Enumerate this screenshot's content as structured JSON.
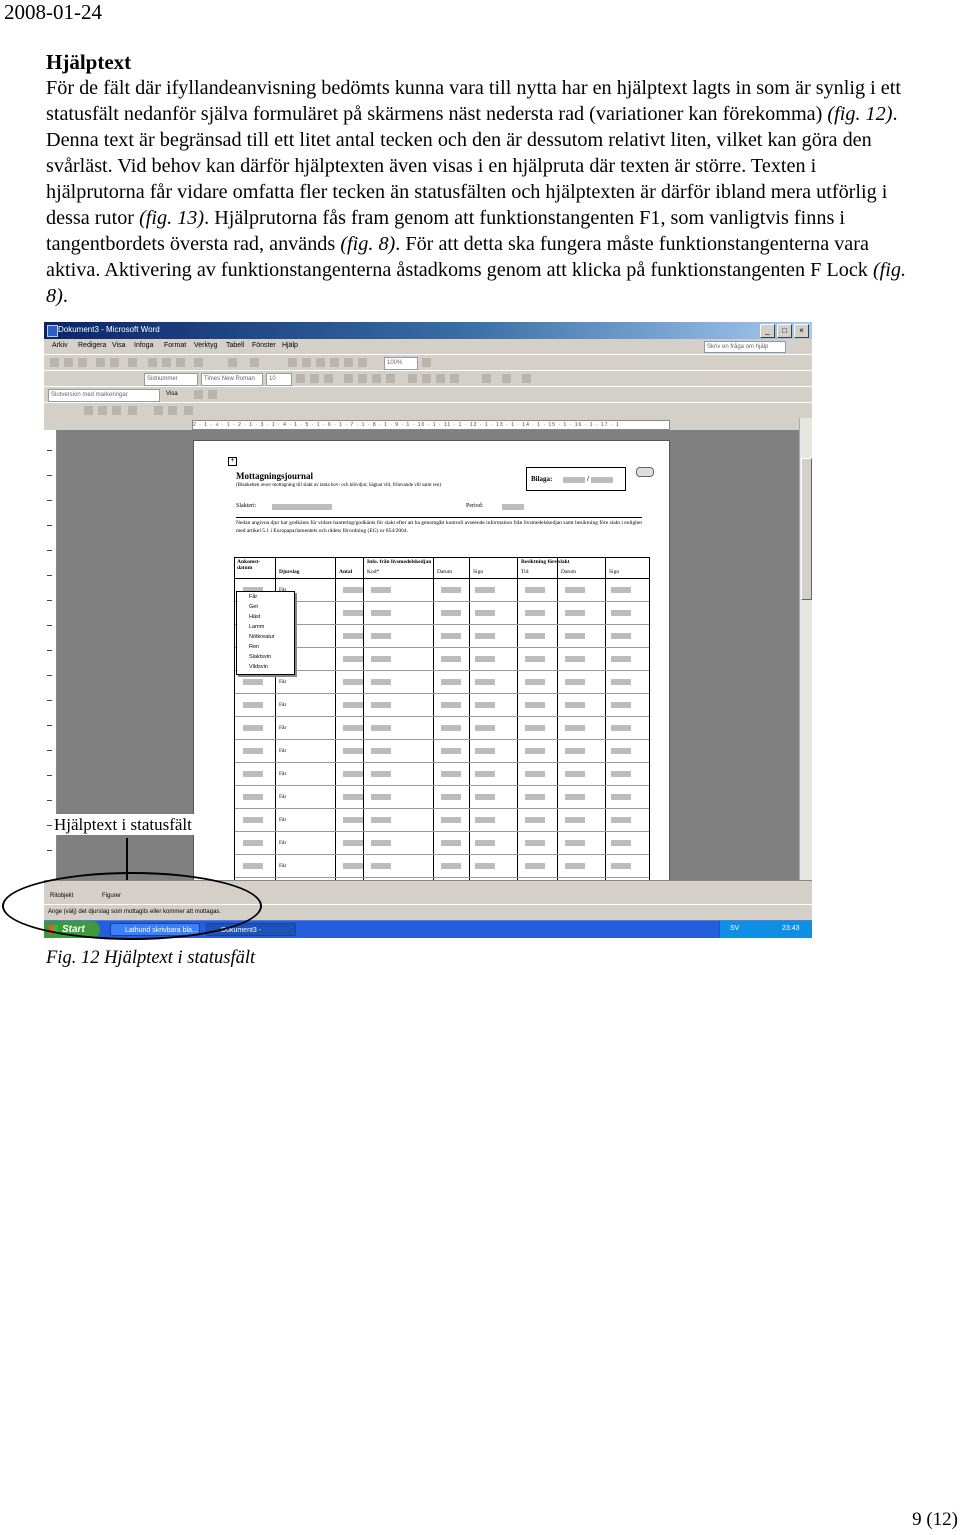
{
  "header": {
    "date": "2008-01-24"
  },
  "section": {
    "title": "Hjälptext"
  },
  "body": {
    "p1": "För de fält där ifyllandeanvisning bedömts kunna vara till nytta har en hjälptext lagts in som är synlig i ett statusfält nedanför själva formuläret på skärmens näst nedersta rad (variationer kan förekomma) ",
    "ref_fig12": "(fig. 12)",
    "p2": ". Denna text är begränsad till ett litet antal tecken och den är dessutom relativt liten, vilket kan göra den svårläst. Vid behov kan därför hjälptexten även visas i en hjälpruta där texten är större. Texten i hjälprutorna får vidare omfatta fler tecken än statusfälten och hjälptexten är därför ibland mera utförlig i dessa rutor ",
    "ref_fig13": "(fig. 13)",
    "p3": ". Hjälprutorna fås fram genom att funktionstangenten F1, som vanligtvis finns i tangentbordets översta rad, används ",
    "ref_fig8a": "(fig. 8)",
    "p4": ". För att detta ska fungera måste funktionstangenterna vara aktiva. Aktivering av funktionstangenterna åstadkoms genom att klicka på funktionstangenten F Lock ",
    "ref_fig8b": "(fig. 8)",
    "p5": "."
  },
  "screenshot": {
    "window_title": "Dokument3 - Microsoft Word",
    "menu": [
      "Arkiv",
      "Redigera",
      "Visa",
      "Infoga",
      "Format",
      "Verktyg",
      "Tabell",
      "Fönster",
      "Hjälp"
    ],
    "help_placeholder": "Skriv en fråga om hjälp",
    "zoom": "100%",
    "style_combo": "Sidnummer",
    "font_combo": "Times New Roman",
    "size_combo": "10",
    "track_combo": "Slutversion med markeringar",
    "show_label": "Visa",
    "ruler_text": "2 · 1 · ⅄ · 1 · 2 · 1 · 3 · 1 · 4 · 1 · 5 · 1 · 6 · 1 · 7 · 1 · 8 · 1 · 9 · 1 · 10 · 1 · 11 · 1 · 12 · 1 · 13 · 1 · 14 · 1 · 15 · 1 · 16 · 1 · 17 · 1",
    "form": {
      "title": "Mottagningsjournal",
      "subtitle": "(Blanketten avser mottagning till slakt av tama hov- och klövdjur, hägnat vilt, frilevande vilt samt ren)",
      "bilaga_label": "Bilaga:",
      "bilaga_sep": "/",
      "slakteri_label": "Slakteri:",
      "period_label": "Period:",
      "intro": "Nedan angivna djur har godkänts för vidare hantering/godkänts för slakt efter att ha genomgått kontroll avseende information från livsmedelskedjan samt besiktning före slakt i enlighet med artikel 5.1 i Europaparlamentets och rådets förordning (EG) nr 854/2004.",
      "columns": {
        "c1": "Ankomst-datum",
        "c2": "Djurslag",
        "c3": "Antal",
        "group1": "Info. från livsmedelskedjan",
        "c4": "Kod*",
        "c5": "Datum",
        "c6": "Sign",
        "group2": "Besiktning före slakt",
        "c7": "Tid",
        "c8": "Datum",
        "c9": "Sign"
      },
      "row_value": "Får",
      "dropdown_options": [
        "Får",
        "Get",
        "Häst",
        "Lamm",
        "Nötkreatur",
        "Ren",
        "Slaktsvin",
        "Vildsvin"
      ]
    },
    "draw_toolbar": {
      "ritobjekt": "Ritobjekt",
      "figurer": "Figurer"
    },
    "status_text": "Ange (välj) det djurslag som mottagits eller kommer att mottagas.",
    "taskbar": {
      "start": "Start",
      "task1": "Lathund skrivbara bla...",
      "task2": "Dokument3 - Microsof...",
      "lang": "SV",
      "clock": "23:43"
    },
    "annotation": "Hjälptext i statusfält"
  },
  "figure": {
    "caption": "Fig. 12 Hjälptext i statusfält"
  },
  "footer": {
    "page": "9 (12)"
  }
}
